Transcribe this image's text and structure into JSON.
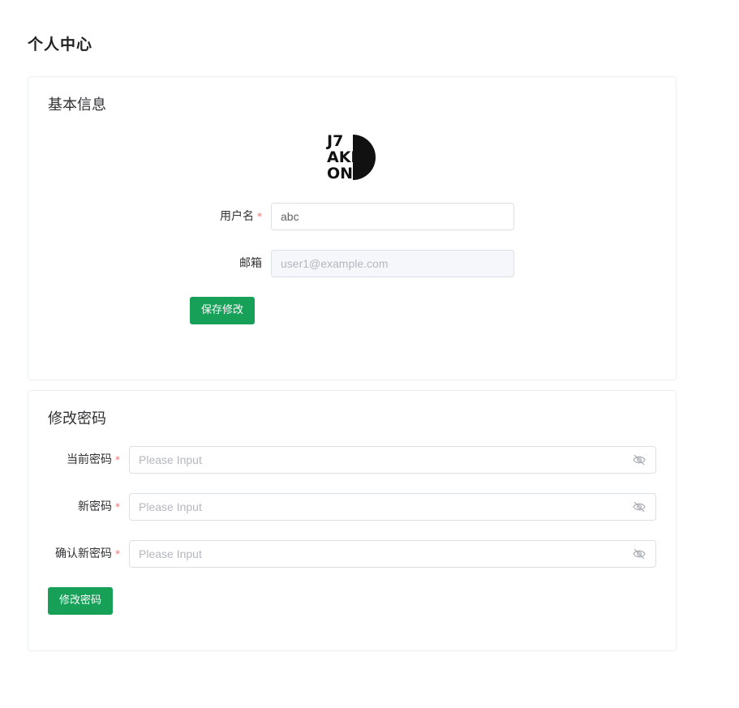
{
  "page": {
    "title": "个人中心"
  },
  "basic_info": {
    "title": "基本信息",
    "avatar_text": [
      "J7",
      "AKI",
      "ONI"
    ],
    "username": {
      "label": "用户名",
      "required_mark": "*",
      "value": "abc"
    },
    "email": {
      "label": "邮箱",
      "placeholder": "user1@example.com"
    },
    "save_button": "保存修改"
  },
  "change_password": {
    "title": "修改密码",
    "current": {
      "label": "当前密码",
      "required_mark": "*",
      "placeholder": "Please Input"
    },
    "new": {
      "label": "新密码",
      "required_mark": "*",
      "placeholder": "Please Input"
    },
    "confirm": {
      "label": "确认新密码",
      "required_mark": "*",
      "placeholder": "Please Input"
    },
    "submit_button": "修改密码"
  },
  "colors": {
    "primary": "#16a058",
    "required": "#f56c6c",
    "border": "#dcdfe6"
  }
}
